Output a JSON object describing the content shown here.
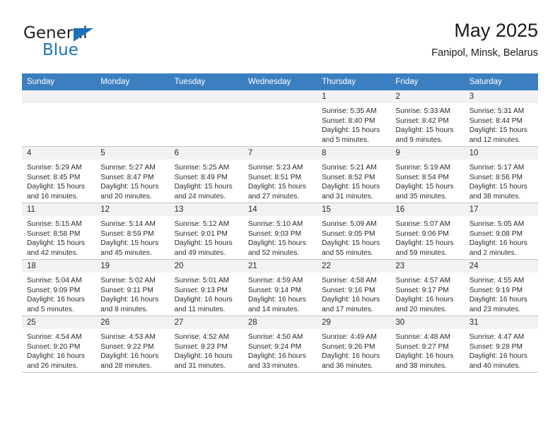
{
  "brand": {
    "name_part1": "General",
    "name_part2": "Blue",
    "accent_color": "#1b72b8"
  },
  "header": {
    "title": "May 2025",
    "subtitle": "Fanipol, Minsk, Belarus"
  },
  "calendar": {
    "header_bg": "#3c7fc1",
    "weekdays": [
      "Sunday",
      "Monday",
      "Tuesday",
      "Wednesday",
      "Thursday",
      "Friday",
      "Saturday"
    ],
    "weeks": [
      [
        {
          "day": "",
          "blank": true
        },
        {
          "day": "",
          "blank": true
        },
        {
          "day": "",
          "blank": true
        },
        {
          "day": "",
          "blank": true
        },
        {
          "day": "1",
          "sunrise": "Sunrise: 5:35 AM",
          "sunset": "Sunset: 8:40 PM",
          "daylight": "Daylight: 15 hours and 5 minutes."
        },
        {
          "day": "2",
          "sunrise": "Sunrise: 5:33 AM",
          "sunset": "Sunset: 8:42 PM",
          "daylight": "Daylight: 15 hours and 9 minutes."
        },
        {
          "day": "3",
          "sunrise": "Sunrise: 5:31 AM",
          "sunset": "Sunset: 8:44 PM",
          "daylight": "Daylight: 15 hours and 12 minutes."
        }
      ],
      [
        {
          "day": "4",
          "sunrise": "Sunrise: 5:29 AM",
          "sunset": "Sunset: 8:45 PM",
          "daylight": "Daylight: 15 hours and 16 minutes."
        },
        {
          "day": "5",
          "sunrise": "Sunrise: 5:27 AM",
          "sunset": "Sunset: 8:47 PM",
          "daylight": "Daylight: 15 hours and 20 minutes."
        },
        {
          "day": "6",
          "sunrise": "Sunrise: 5:25 AM",
          "sunset": "Sunset: 8:49 PM",
          "daylight": "Daylight: 15 hours and 24 minutes."
        },
        {
          "day": "7",
          "sunrise": "Sunrise: 5:23 AM",
          "sunset": "Sunset: 8:51 PM",
          "daylight": "Daylight: 15 hours and 27 minutes."
        },
        {
          "day": "8",
          "sunrise": "Sunrise: 5:21 AM",
          "sunset": "Sunset: 8:52 PM",
          "daylight": "Daylight: 15 hours and 31 minutes."
        },
        {
          "day": "9",
          "sunrise": "Sunrise: 5:19 AM",
          "sunset": "Sunset: 8:54 PM",
          "daylight": "Daylight: 15 hours and 35 minutes."
        },
        {
          "day": "10",
          "sunrise": "Sunrise: 5:17 AM",
          "sunset": "Sunset: 8:56 PM",
          "daylight": "Daylight: 15 hours and 38 minutes."
        }
      ],
      [
        {
          "day": "11",
          "sunrise": "Sunrise: 5:15 AM",
          "sunset": "Sunset: 8:58 PM",
          "daylight": "Daylight: 15 hours and 42 minutes."
        },
        {
          "day": "12",
          "sunrise": "Sunrise: 5:14 AM",
          "sunset": "Sunset: 8:59 PM",
          "daylight": "Daylight: 15 hours and 45 minutes."
        },
        {
          "day": "13",
          "sunrise": "Sunrise: 5:12 AM",
          "sunset": "Sunset: 9:01 PM",
          "daylight": "Daylight: 15 hours and 49 minutes."
        },
        {
          "day": "14",
          "sunrise": "Sunrise: 5:10 AM",
          "sunset": "Sunset: 9:03 PM",
          "daylight": "Daylight: 15 hours and 52 minutes."
        },
        {
          "day": "15",
          "sunrise": "Sunrise: 5:09 AM",
          "sunset": "Sunset: 9:05 PM",
          "daylight": "Daylight: 15 hours and 55 minutes."
        },
        {
          "day": "16",
          "sunrise": "Sunrise: 5:07 AM",
          "sunset": "Sunset: 9:06 PM",
          "daylight": "Daylight: 15 hours and 59 minutes."
        },
        {
          "day": "17",
          "sunrise": "Sunrise: 5:05 AM",
          "sunset": "Sunset: 9:08 PM",
          "daylight": "Daylight: 16 hours and 2 minutes."
        }
      ],
      [
        {
          "day": "18",
          "sunrise": "Sunrise: 5:04 AM",
          "sunset": "Sunset: 9:09 PM",
          "daylight": "Daylight: 16 hours and 5 minutes."
        },
        {
          "day": "19",
          "sunrise": "Sunrise: 5:02 AM",
          "sunset": "Sunset: 9:11 PM",
          "daylight": "Daylight: 16 hours and 8 minutes."
        },
        {
          "day": "20",
          "sunrise": "Sunrise: 5:01 AM",
          "sunset": "Sunset: 9:13 PM",
          "daylight": "Daylight: 16 hours and 11 minutes."
        },
        {
          "day": "21",
          "sunrise": "Sunrise: 4:59 AM",
          "sunset": "Sunset: 9:14 PM",
          "daylight": "Daylight: 16 hours and 14 minutes."
        },
        {
          "day": "22",
          "sunrise": "Sunrise: 4:58 AM",
          "sunset": "Sunset: 9:16 PM",
          "daylight": "Daylight: 16 hours and 17 minutes."
        },
        {
          "day": "23",
          "sunrise": "Sunrise: 4:57 AM",
          "sunset": "Sunset: 9:17 PM",
          "daylight": "Daylight: 16 hours and 20 minutes."
        },
        {
          "day": "24",
          "sunrise": "Sunrise: 4:55 AM",
          "sunset": "Sunset: 9:19 PM",
          "daylight": "Daylight: 16 hours and 23 minutes."
        }
      ],
      [
        {
          "day": "25",
          "sunrise": "Sunrise: 4:54 AM",
          "sunset": "Sunset: 9:20 PM",
          "daylight": "Daylight: 16 hours and 26 minutes."
        },
        {
          "day": "26",
          "sunrise": "Sunrise: 4:53 AM",
          "sunset": "Sunset: 9:22 PM",
          "daylight": "Daylight: 16 hours and 28 minutes."
        },
        {
          "day": "27",
          "sunrise": "Sunrise: 4:52 AM",
          "sunset": "Sunset: 9:23 PM",
          "daylight": "Daylight: 16 hours and 31 minutes."
        },
        {
          "day": "28",
          "sunrise": "Sunrise: 4:50 AM",
          "sunset": "Sunset: 9:24 PM",
          "daylight": "Daylight: 16 hours and 33 minutes."
        },
        {
          "day": "29",
          "sunrise": "Sunrise: 4:49 AM",
          "sunset": "Sunset: 9:26 PM",
          "daylight": "Daylight: 16 hours and 36 minutes."
        },
        {
          "day": "30",
          "sunrise": "Sunrise: 4:48 AM",
          "sunset": "Sunset: 9:27 PM",
          "daylight": "Daylight: 16 hours and 38 minutes."
        },
        {
          "day": "31",
          "sunrise": "Sunrise: 4:47 AM",
          "sunset": "Sunset: 9:28 PM",
          "daylight": "Daylight: 16 hours and 40 minutes."
        }
      ]
    ]
  }
}
